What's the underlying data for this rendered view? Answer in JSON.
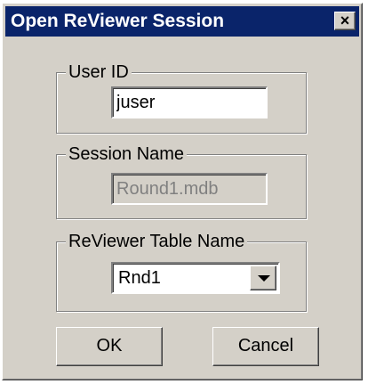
{
  "window": {
    "title": "Open ReViewer Session",
    "close_label": "×"
  },
  "user_group": {
    "label": "User ID",
    "value": "juser"
  },
  "session_group": {
    "label": "Session Name",
    "value": "Round1.mdb"
  },
  "table_group": {
    "label": "ReViewer Table Name",
    "selected": "Rnd1"
  },
  "buttons": {
    "ok": "OK",
    "cancel": "Cancel"
  },
  "colors": {
    "title_bar": "#0a246a",
    "dialog_bg": "#d4d0c8"
  },
  "icons": {
    "close": "close-icon",
    "dropdown": "chevron-down-icon"
  }
}
